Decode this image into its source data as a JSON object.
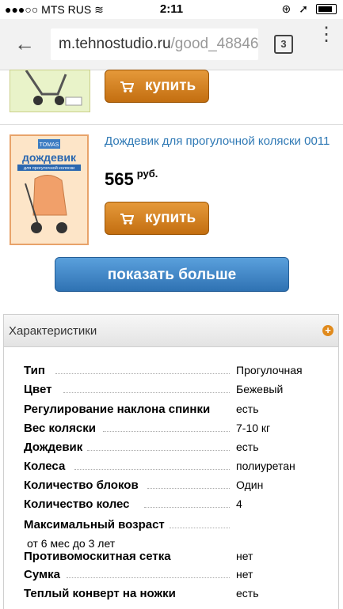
{
  "status_bar": {
    "carrier": "MTS RUS",
    "time": "2:11"
  },
  "browser": {
    "url_main": "m.tehnostudio.ru",
    "url_dim": "/good_48846",
    "tab_count": "3"
  },
  "products": [
    {
      "buy_label": "купить"
    },
    {
      "title": "Дождевик для прогулочной коляски 0011",
      "price": "565",
      "currency": "руб.",
      "buy_label": "купить",
      "box_label": "дождевик",
      "box_sub": "для прогулочной коляски"
    }
  ],
  "show_more": "показать больше",
  "specs": {
    "header": "Характеристики",
    "rows": [
      {
        "key": "Тип",
        "value": "Прогулочная"
      },
      {
        "key": "Цвет",
        "value": "Бежевый"
      },
      {
        "key": "Регулирование наклона спинки",
        "value": "есть"
      },
      {
        "key": "Вес коляски",
        "value": "7-10 кг"
      },
      {
        "key": "Дождевик",
        "value": "есть"
      },
      {
        "key": "Колеса",
        "value": "полиуретан"
      },
      {
        "key": "Количество блоков",
        "value": "Один"
      },
      {
        "key": "Количество колес",
        "value": "4"
      },
      {
        "key": "Максимальный возраст",
        "value": ""
      },
      {
        "key": "Противомоскитная сетка",
        "value": "нет"
      },
      {
        "key": "Сумка",
        "value": "нет"
      },
      {
        "key": "Теплый конверт на ножки",
        "value": "есть"
      }
    ],
    "max_age_value": "от 6 мес до 3 лет"
  },
  "colors": {
    "buy": "#d2821f",
    "more": "#3a7fc0",
    "link": "#2f79b5"
  }
}
